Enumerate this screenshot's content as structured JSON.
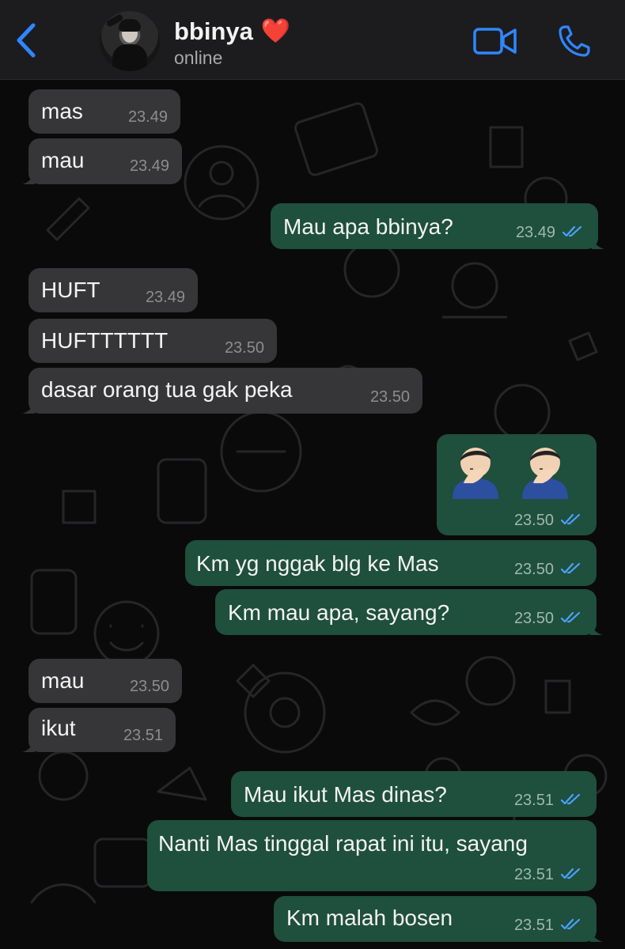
{
  "contact": {
    "name": "bbinya",
    "heart": "❤️",
    "status": "online"
  },
  "icons": {
    "back": "chevron-left-icon",
    "video": "video-call-icon",
    "phone": "phone-call-icon",
    "read": "double-check-icon",
    "emoji": "man-facepalming-emoji"
  },
  "colors": {
    "accent": "#2f86ff",
    "incoming_bubble": "#363638",
    "outgoing_bubble": "#1f4f3d",
    "read_ticks": "#4aa3ff"
  },
  "messages": [
    {
      "dir": "in",
      "text": "mas",
      "time": "23.49"
    },
    {
      "dir": "in",
      "text": "mau",
      "time": "23.49"
    },
    {
      "dir": "out",
      "text": "Mau apa bbinya?",
      "time": "23.49"
    },
    {
      "dir": "in",
      "text": "HUFT",
      "time": "23.49"
    },
    {
      "dir": "in",
      "text": "HUFTTTTTT",
      "time": "23.50"
    },
    {
      "dir": "in",
      "text": "dasar orang tua gak peka",
      "time": "23.50"
    },
    {
      "dir": "out",
      "text": "🤦🏻‍♂️🤦🏻‍♂️",
      "time": "23.50"
    },
    {
      "dir": "out",
      "text": "Km yg nggak blg ke Mas",
      "time": "23.50"
    },
    {
      "dir": "out",
      "text": "Km mau apa, sayang?",
      "time": "23.50"
    },
    {
      "dir": "in",
      "text": "mau",
      "time": "23.50"
    },
    {
      "dir": "in",
      "text": "ikut",
      "time": "23.51"
    },
    {
      "dir": "out",
      "text": "Mau ikut Mas dinas?",
      "time": "23.51"
    },
    {
      "dir": "out",
      "text": "Nanti Mas tinggal rapat ini itu, sayang",
      "time": "23.51"
    },
    {
      "dir": "out",
      "text": "Km malah bosen",
      "time": "23.51"
    }
  ]
}
